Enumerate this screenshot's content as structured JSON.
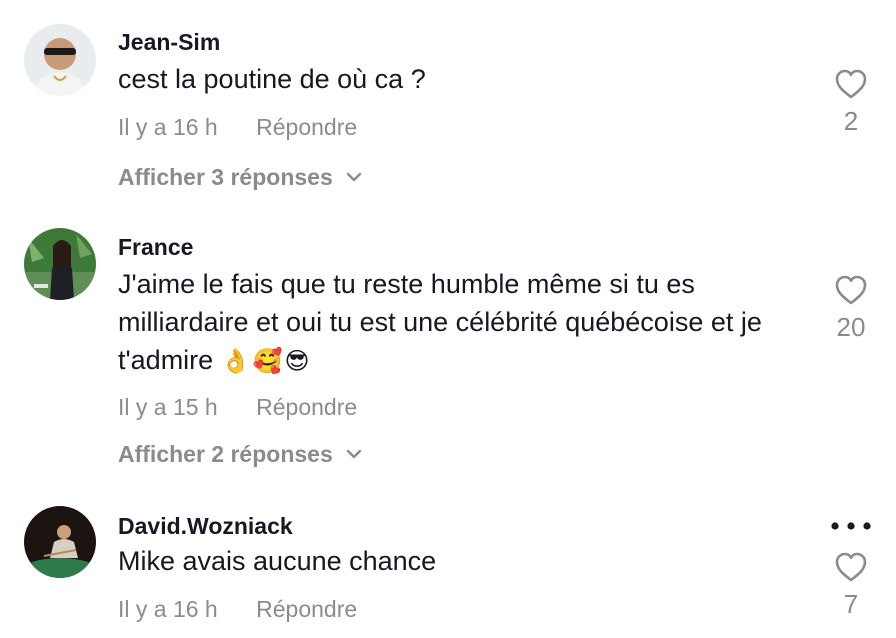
{
  "comments": [
    {
      "username": "Jean-Sim",
      "text": "cest la poutine de où ca ?",
      "time": "Il y a 16 h",
      "reply": "Répondre",
      "replies": "Afficher 3 réponses",
      "likes": "2",
      "avatar_icon": "user-avatar"
    },
    {
      "username": "France",
      "text": "J'aime le fais que tu reste humble même si tu es milliardaire et oui tu est une célébrité québécoise et je t'admire",
      "emoji": "👌🥰😎",
      "time": "Il y a 15 h",
      "reply": "Répondre",
      "replies": "Afficher 2 réponses",
      "likes": "20",
      "avatar_icon": "user-avatar"
    },
    {
      "username": "David.Wozniack",
      "text": "Mike avais aucune chance",
      "time": "Il y a 16 h",
      "reply": "Répondre",
      "likes": "7",
      "avatar_icon": "user-avatar"
    }
  ],
  "colors": {
    "text": "#161823",
    "muted": "#8a8b91",
    "background": "#ffffff"
  },
  "icons": [
    "heart-icon",
    "chevron-down-icon",
    "more-options-icon"
  ]
}
